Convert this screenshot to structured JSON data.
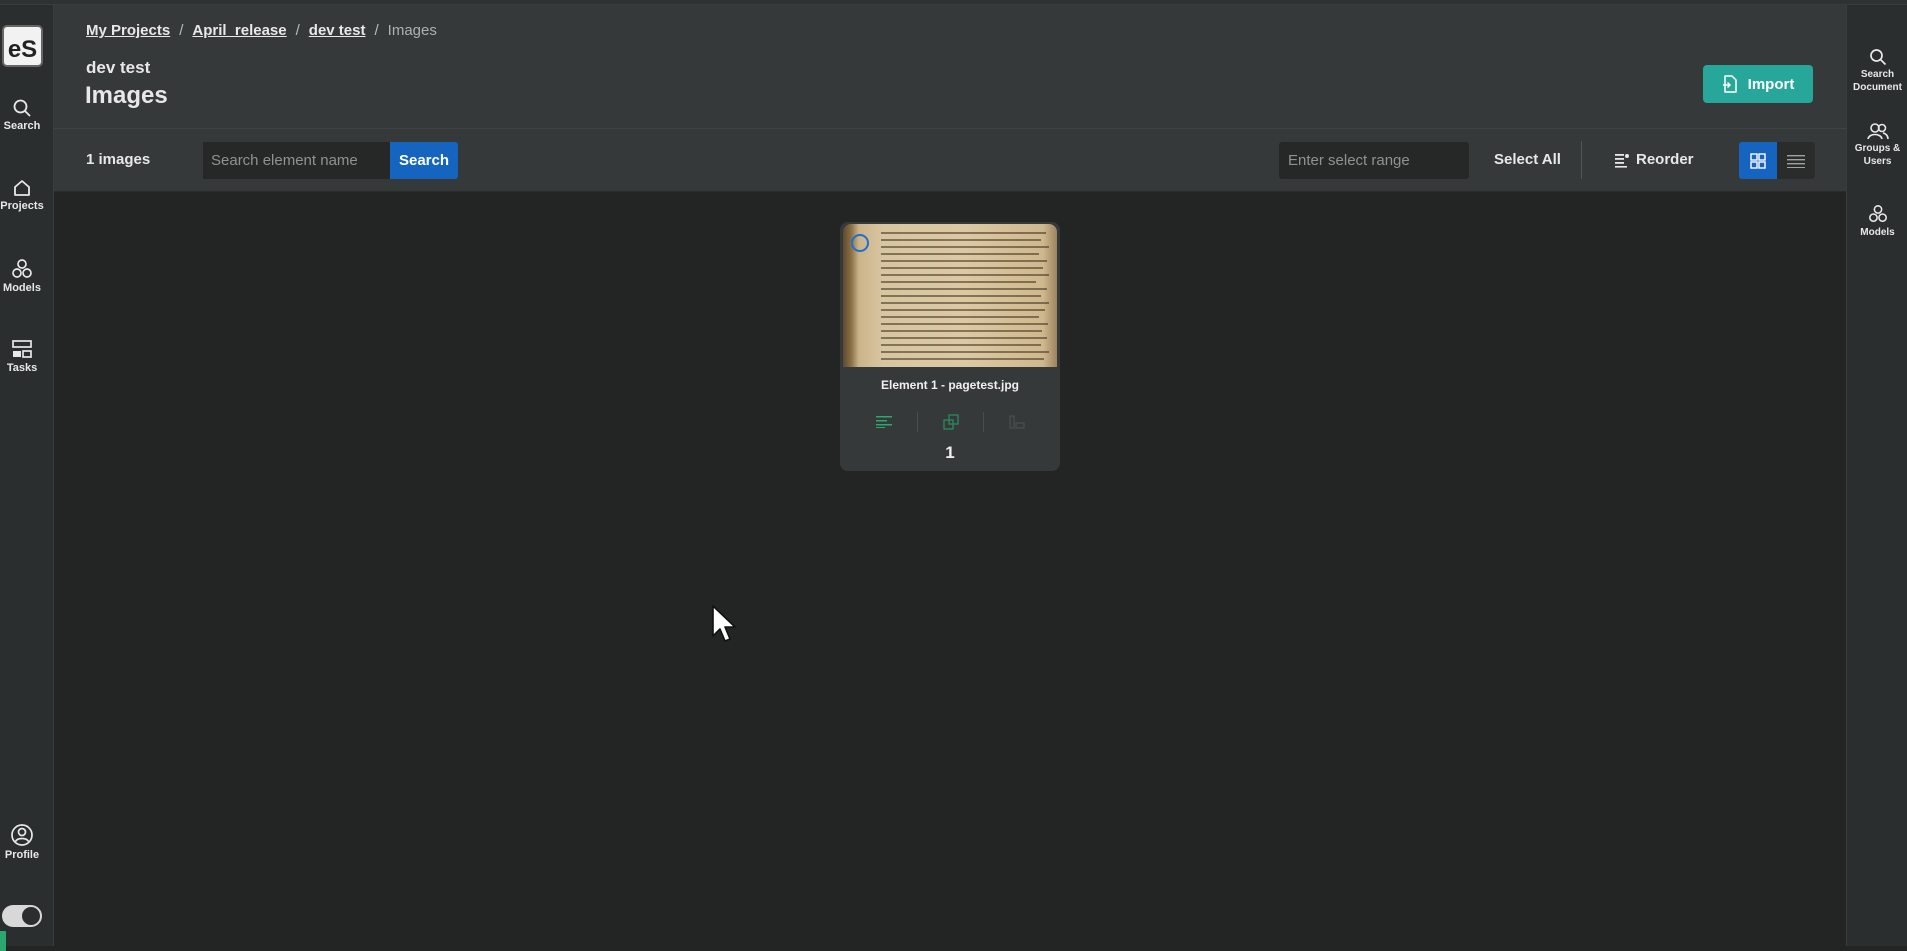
{
  "app": {
    "logo_text": "eS"
  },
  "left_nav": {
    "items": [
      {
        "label": "Search",
        "icon": "search-icon"
      },
      {
        "label": "Projects",
        "icon": "home-icon"
      },
      {
        "label": "Models",
        "icon": "models-icon"
      },
      {
        "label": "Tasks",
        "icon": "tasks-icon"
      }
    ],
    "profile_label": "Profile"
  },
  "right_nav": {
    "items": [
      {
        "label_line1": "Search",
        "label_line2": "Document",
        "icon": "search-icon"
      },
      {
        "label_line1": "Groups &",
        "label_line2": "Users",
        "icon": "users-icon"
      },
      {
        "label_line1": "Models",
        "label_line2": "",
        "icon": "models-icon"
      }
    ]
  },
  "breadcrumb": {
    "items": [
      "My Projects",
      "April_release",
      "dev test"
    ],
    "current": "Images",
    "separator": "/"
  },
  "header": {
    "subtitle": "dev test",
    "title": "Images",
    "import_label": "Import"
  },
  "toolbar": {
    "count_label": "1 images",
    "search_placeholder": "Search element name",
    "search_button": "Search",
    "range_placeholder": "Enter select range",
    "select_all": "Select All",
    "reorder": "Reorder",
    "view_mode": "grid"
  },
  "elements": [
    {
      "name": "Element 1 - pagetest.jpg",
      "count": "1"
    }
  ],
  "colors": {
    "accent_teal": "#26a79a",
    "primary_blue": "#1565c0",
    "success_green": "#2aa86e"
  }
}
